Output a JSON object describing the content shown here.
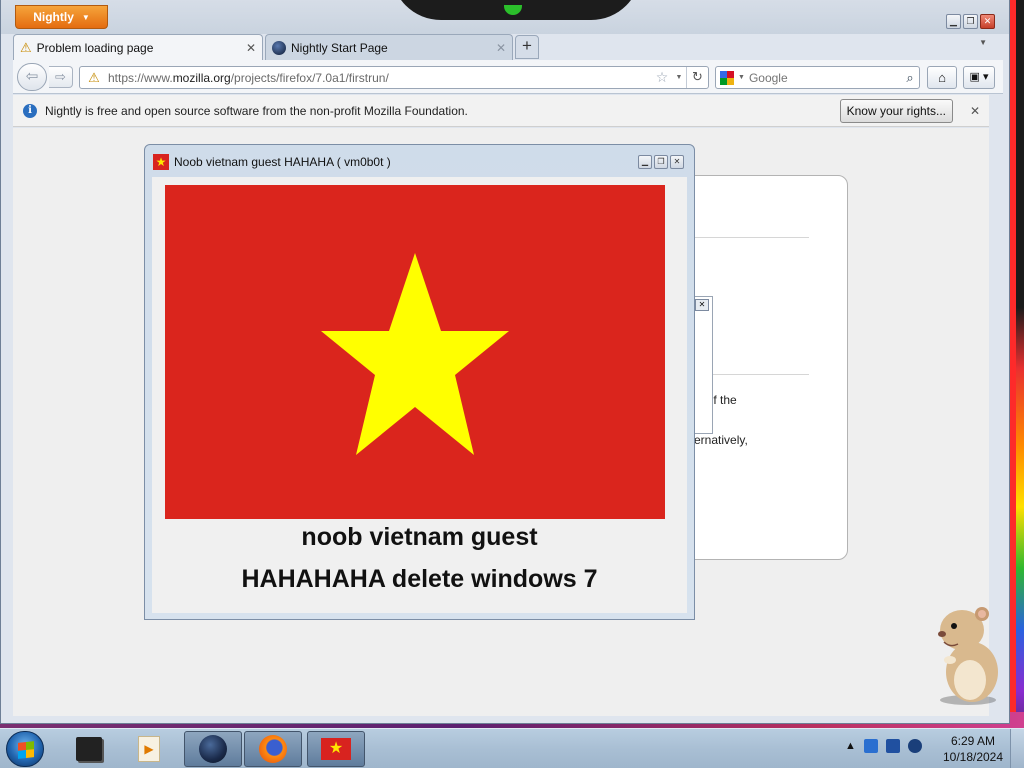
{
  "app": {
    "menu_button": "Nightly",
    "window_controls": [
      "minimize",
      "maximize",
      "close"
    ]
  },
  "tabs": [
    {
      "label": "Problem loading page",
      "icon": "warning-icon",
      "active": true
    },
    {
      "label": "Nightly Start Page",
      "icon": "nightly-globe-icon",
      "active": false
    }
  ],
  "navbar": {
    "url_prefix": "https://www.",
    "url_domain": "mozilla.org",
    "url_path": "/projects/firefox/7.0a1/firstrun/",
    "search_engine": "Google",
    "search_placeholder": "Google"
  },
  "notification": {
    "message": "Nightly is free and open source software from the non-profit Mozilla Foundation.",
    "button": "Know your rights..."
  },
  "background_page": {
    "fragment_1": "ty of the",
    "fragment_2": "ernatively,"
  },
  "popup": {
    "title": "Noob vietnam guest HAHAHA ( vm0b0t )",
    "caption_line_1": "noob vietnam guest",
    "caption_line_2": "HAHAHAHA delete windows 7",
    "flag_colors": {
      "field": "#da251d",
      "star": "#ffff00"
    }
  },
  "taskbar": {
    "items": [
      "media-icon",
      "media-player-icon",
      "nightly-globe-icon",
      "firefox-icon",
      "vietnam-flag-icon"
    ],
    "active_items": [
      "nightly-globe-icon",
      "firefox-icon",
      "vietnam-flag-icon"
    ],
    "time": "6:29 AM",
    "date": "10/18/2024"
  },
  "colors": {
    "nightly_orange": "#e46c10",
    "taskbar": "#a9bfd4",
    "flag_red": "#da251d",
    "flag_yellow": "#ffff00"
  }
}
